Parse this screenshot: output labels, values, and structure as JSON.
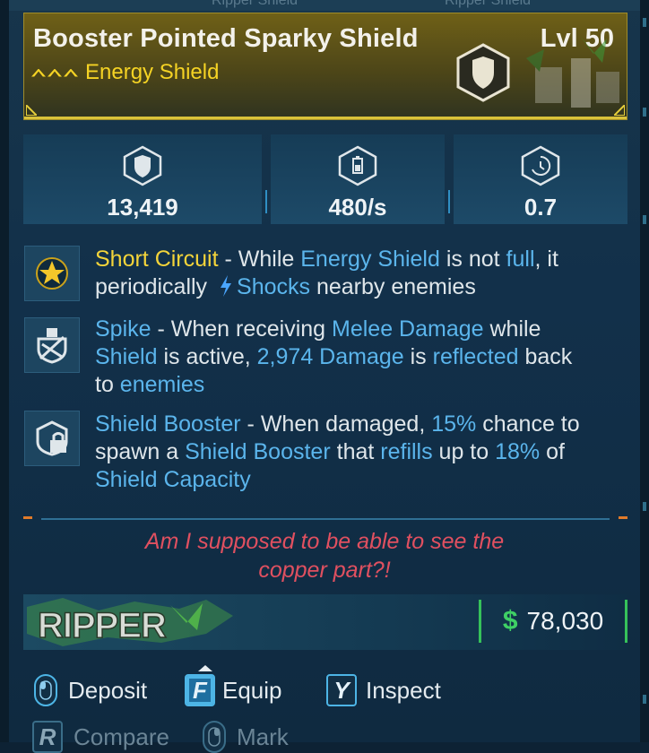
{
  "top_strip": {
    "left_ghost": "Ripper Shield",
    "right_ghost": "Ripper Shield"
  },
  "item": {
    "name": "Booster Pointed Sparky Shield",
    "level": "Lvl 50",
    "type": "Energy Shield",
    "rarity_color": "#f5d324",
    "icon": "shield-icon"
  },
  "stats": [
    {
      "icon": "capacity-shield-icon",
      "value": "13,419"
    },
    {
      "icon": "recharge-rate-icon",
      "value": "480/s"
    },
    {
      "icon": "recharge-delay-icon",
      "value": "0.7"
    }
  ],
  "perks": [
    {
      "icon": "star-perk-icon",
      "name": "Short Circuit",
      "parts": {
        "a": " - While ",
        "b": "Energy Shield",
        "c": " is not ",
        "d": "full",
        "e": ", it",
        "f": "periodically ",
        "g": "Shocks",
        "h": " nearby enemies"
      }
    },
    {
      "icon": "spike-perk-icon",
      "name": "Spike",
      "parts": {
        "a": " - When receiving ",
        "b": "Melee Damage",
        "c": " while",
        "d": "Shield",
        "e": " is active, ",
        "f": "2,974 Damage",
        "g": " is ",
        "h": "reflected",
        "i": " back",
        "j": "to ",
        "k": "enemies"
      }
    },
    {
      "icon": "booster-perk-icon",
      "name": "Shield Booster",
      "parts": {
        "a": " - When damaged, ",
        "b": "15%",
        "c": " chance to",
        "d": "spawn a ",
        "e": "Shield Booster",
        "f": " that ",
        "g": "refills",
        "h": " up to ",
        "i": "18%",
        "j": " of",
        "k": "Shield Capacity"
      }
    }
  ],
  "flavor_text": {
    "line1": "Am I supposed to be able to see the",
    "line2": "copper part?!"
  },
  "manufacturer": {
    "logo_text": "RIPPER"
  },
  "price": {
    "symbol": "$",
    "amount": "78,030"
  },
  "actions": [
    {
      "key": "",
      "label": "Deposit",
      "icon": "mouse-left-icon"
    },
    {
      "key": "F",
      "label": "Equip",
      "icon": "key-f-icon"
    },
    {
      "key": "Y",
      "label": "Inspect",
      "icon": "key-y-icon"
    },
    {
      "key": "R",
      "label": "Compare",
      "icon": "key-r-icon"
    },
    {
      "key": "",
      "label": "Mark",
      "icon": "mouse-right-icon"
    }
  ],
  "colors": {
    "highlight_blue": "#5bb5ec",
    "highlight_yellow": "#f4d43a",
    "flavor_red": "#e05060",
    "price_green": "#3fd065",
    "accent_orange": "#e07b2a"
  }
}
